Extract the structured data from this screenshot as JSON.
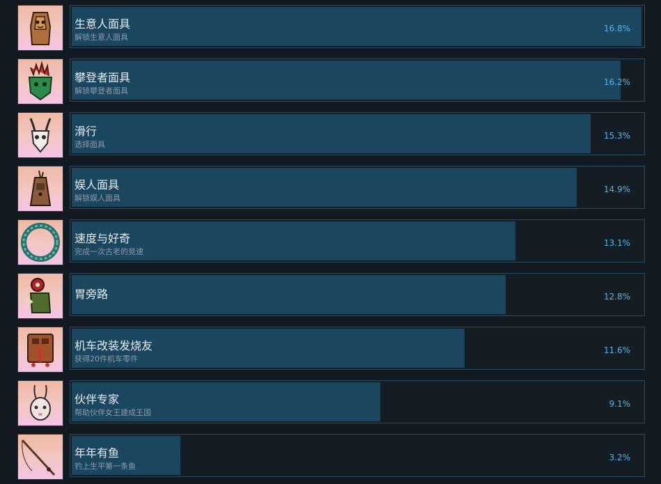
{
  "achievements": [
    {
      "title": "生意人面具",
      "description": "解锁生意人面具",
      "percent_label": "16.8%",
      "percent": 16.8,
      "icon": "merchant-mask-icon"
    },
    {
      "title": "攀登者面具",
      "description": "解锁攀登者面具",
      "percent_label": "16.2%",
      "percent": 16.2,
      "icon": "climber-mask-icon"
    },
    {
      "title": "滑行",
      "description": "选择面具",
      "percent_label": "15.3%",
      "percent": 15.3,
      "icon": "glide-mask-icon"
    },
    {
      "title": "娱人面具",
      "description": "解锁娱人面具",
      "percent_label": "14.9%",
      "percent": 14.9,
      "icon": "entertainer-mask-icon"
    },
    {
      "title": "速度与好奇",
      "description": "完成一次古老的竞速",
      "percent_label": "13.1%",
      "percent": 13.1,
      "icon": "ring-icon"
    },
    {
      "title": "胃旁路",
      "description": "",
      "percent_label": "12.8%",
      "percent": 12.8,
      "icon": "creature-icon"
    },
    {
      "title": "机车改装发烧友",
      "description": "获得20件机车零件",
      "percent_label": "11.6%",
      "percent": 11.6,
      "icon": "machine-icon"
    },
    {
      "title": "伙伴专家",
      "description": "帮助伙伴女王建成王国",
      "percent_label": "9.1%",
      "percent": 9.1,
      "icon": "rabbit-mask-icon"
    },
    {
      "title": "年年有鱼",
      "description": "钓上生平第一条鱼",
      "percent_label": "3.2%",
      "percent": 3.2,
      "icon": "fishing-rod-icon"
    }
  ]
}
